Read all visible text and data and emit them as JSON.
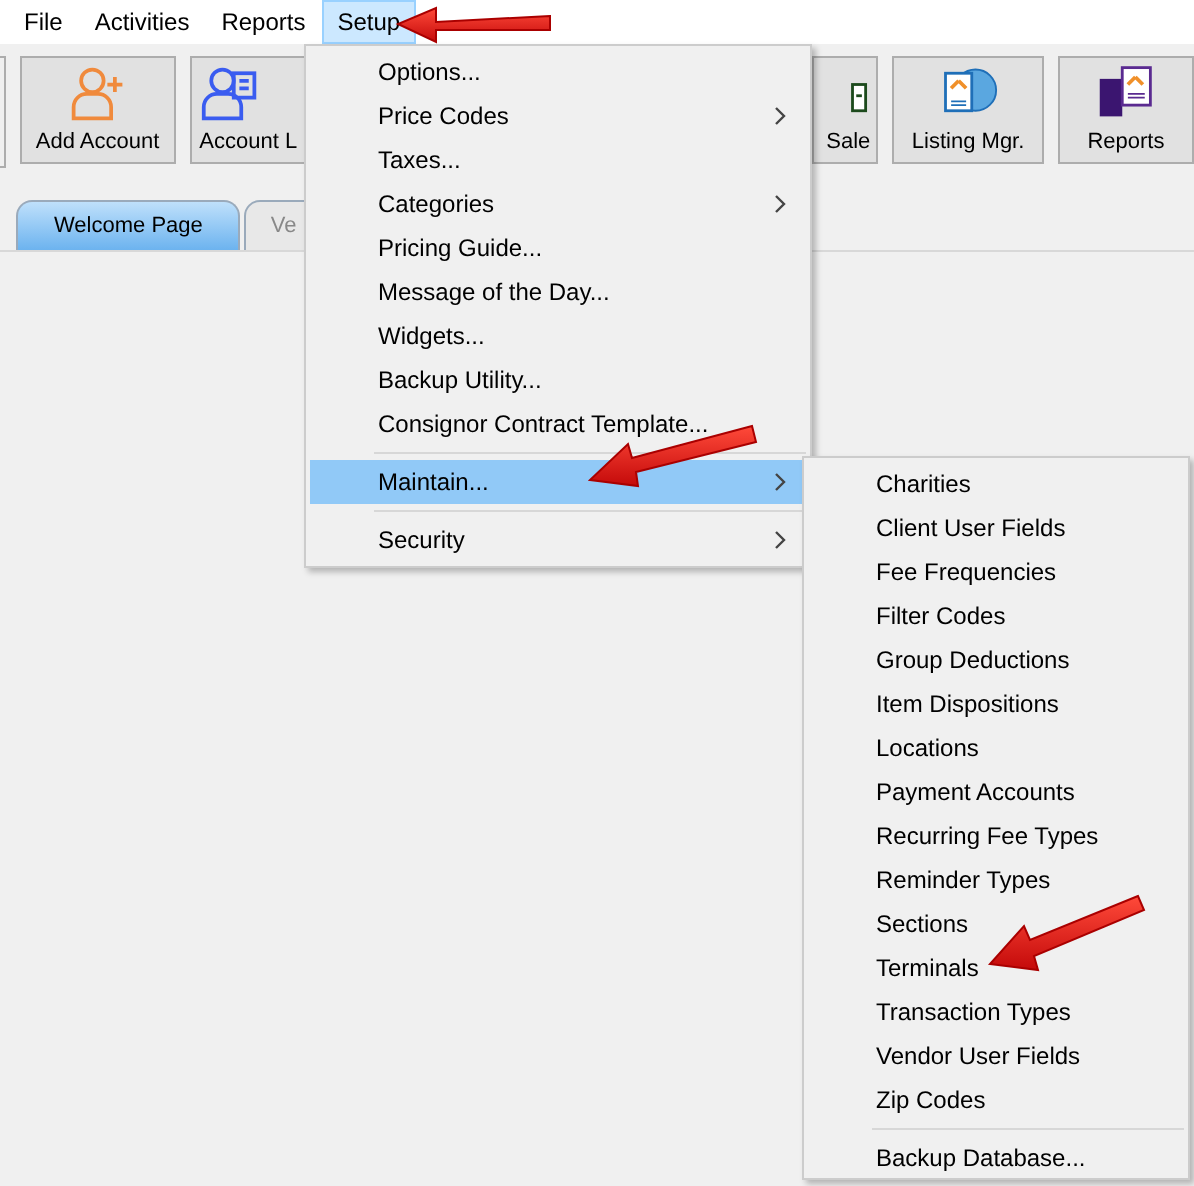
{
  "menubar": [
    {
      "label": "File",
      "selected": false
    },
    {
      "label": "Activities",
      "selected": false
    },
    {
      "label": "Reports",
      "selected": false
    },
    {
      "label": "Setup",
      "selected": true
    }
  ],
  "toolbar": [
    {
      "label": "Add Account",
      "kind": "add-account"
    },
    {
      "label": "Account L",
      "kind": "account-list"
    },
    {
      "label": "Sale",
      "kind": "sale"
    },
    {
      "label": "Listing Mgr.",
      "kind": "listing"
    },
    {
      "label": "Reports",
      "kind": "reports"
    }
  ],
  "tabs": [
    {
      "label": "Welcome Page",
      "selected": true
    },
    {
      "label": "Ve",
      "selected": false
    }
  ],
  "setup_menu": [
    {
      "kind": "item",
      "label": "Options...",
      "submenu": false,
      "selected": false
    },
    {
      "kind": "item",
      "label": "Price Codes",
      "submenu": true,
      "selected": false
    },
    {
      "kind": "item",
      "label": "Taxes...",
      "submenu": false,
      "selected": false
    },
    {
      "kind": "item",
      "label": "Categories",
      "submenu": true,
      "selected": false
    },
    {
      "kind": "item",
      "label": "Pricing Guide...",
      "submenu": false,
      "selected": false
    },
    {
      "kind": "item",
      "label": "Message of the Day...",
      "submenu": false,
      "selected": false
    },
    {
      "kind": "item",
      "label": "Widgets...",
      "submenu": false,
      "selected": false
    },
    {
      "kind": "item",
      "label": "Backup Utility...",
      "submenu": false,
      "selected": false
    },
    {
      "kind": "item",
      "label": "Consignor Contract Template...",
      "submenu": false,
      "selected": false
    },
    {
      "kind": "separator"
    },
    {
      "kind": "item",
      "label": "Maintain...",
      "submenu": true,
      "selected": true
    },
    {
      "kind": "separator"
    },
    {
      "kind": "item",
      "label": "Security",
      "submenu": true,
      "selected": false
    }
  ],
  "maintain_menu": [
    {
      "kind": "item",
      "label": "Charities"
    },
    {
      "kind": "item",
      "label": "Client User Fields"
    },
    {
      "kind": "item",
      "label": "Fee Frequencies"
    },
    {
      "kind": "item",
      "label": "Filter Codes"
    },
    {
      "kind": "item",
      "label": "Group Deductions"
    },
    {
      "kind": "item",
      "label": "Item Dispositions"
    },
    {
      "kind": "item",
      "label": "Locations"
    },
    {
      "kind": "item",
      "label": "Payment Accounts"
    },
    {
      "kind": "item",
      "label": "Recurring Fee Types"
    },
    {
      "kind": "item",
      "label": "Reminder Types"
    },
    {
      "kind": "item",
      "label": "Sections"
    },
    {
      "kind": "item",
      "label": "Terminals"
    },
    {
      "kind": "item",
      "label": "Transaction Types"
    },
    {
      "kind": "item",
      "label": "Vendor User Fields"
    },
    {
      "kind": "item",
      "label": "Zip Codes"
    },
    {
      "kind": "separator"
    },
    {
      "kind": "item",
      "label": "Backup Database..."
    }
  ]
}
